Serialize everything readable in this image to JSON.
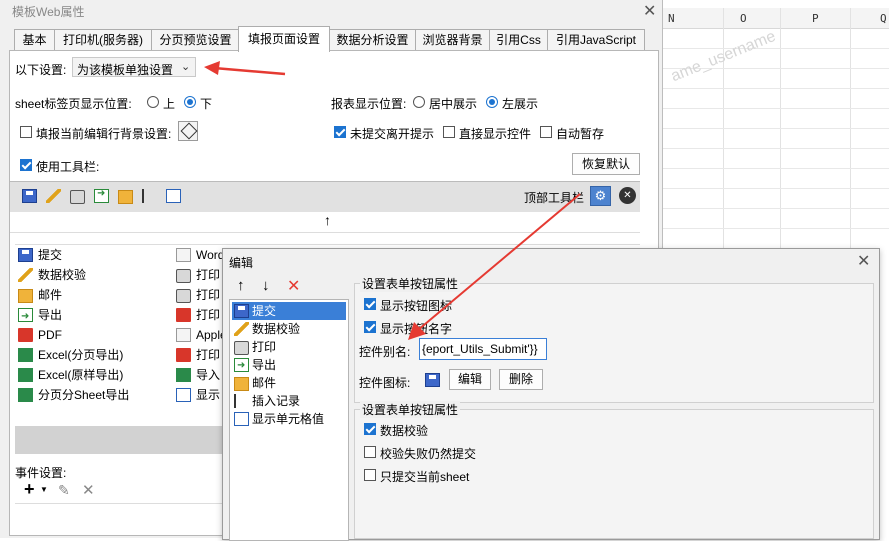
{
  "spreadsheet": {
    "columns": [
      "N",
      "O",
      "P",
      "Q"
    ],
    "watermark": "ame_username"
  },
  "main_dialog": {
    "title": "模板Web属性",
    "tabs": [
      {
        "label": "基本",
        "selected": false
      },
      {
        "label": "打印机(服务器)",
        "selected": false
      },
      {
        "label": "分页预览设置",
        "selected": false
      },
      {
        "label": "填报页面设置",
        "selected": true
      },
      {
        "label": "数据分析设置",
        "selected": false
      },
      {
        "label": "浏览器背景",
        "selected": false
      },
      {
        "label": "引用Css",
        "selected": false
      },
      {
        "label": "引用JavaScript",
        "selected": false
      }
    ],
    "settings_label": "以下设置:",
    "settings_select": "为该模板单独设置",
    "sheet_tab_pos_label": "sheet标签页显示位置:",
    "sheet_tab_pos_options": [
      "上",
      "下"
    ],
    "sheet_tab_pos_selected": "下",
    "report_pos_label": "报表显示位置:",
    "report_pos_options": [
      "居中展示",
      "左展示"
    ],
    "report_pos_selected": "左展示",
    "fill_row_bg_label": "填报当前编辑行背景设置:",
    "fill_row_bg_checked": false,
    "unsubmitted_leave_label": "未提交离开提示",
    "unsubmitted_leave_checked": true,
    "direct_show_control_label": "直接显示控件",
    "direct_show_control_checked": false,
    "auto_save_label": "自动暂存",
    "auto_save_checked": false,
    "use_toolbar_label": "使用工具栏:",
    "use_toolbar_checked": true,
    "restore_default_button": "恢复默认",
    "top_toolbar_label": "顶部工具栏",
    "move_up_arrow": "↑",
    "button_list_col1": [
      "提交",
      "数据校验",
      "邮件",
      "导出",
      "PDF",
      "Excel(分页导出)",
      "Excel(原样导出)",
      "分页分Sheet导出"
    ],
    "button_list_col2": [
      "Word",
      "打印",
      "打印",
      "打印",
      "Apple",
      "打印",
      "导入",
      "显示"
    ],
    "event_settings_label": "事件设置:",
    "event_add_icon": "+",
    "event_delete_icon": "✕"
  },
  "edit_dialog": {
    "title": "编辑",
    "items": [
      "提交",
      "数据校验",
      "打印",
      "导出",
      "邮件",
      "插入记录",
      "显示单元格值"
    ],
    "selected_index": 0,
    "group1_title": "设置表单按钮属性",
    "show_icon_label": "显示按钮图标",
    "show_icon_checked": true,
    "show_name_label": "显示按钮名字",
    "show_name_checked": true,
    "control_alias_label": "控件别名:",
    "control_alias_value": "{eport_Utils_Submit'}}",
    "control_icon_label": "控件图标:",
    "edit_button": "编辑",
    "delete_button": "删除",
    "group2_title": "设置表单按钮属性",
    "data_validate_label": "数据校验",
    "data_validate_checked": true,
    "submit_on_fail_label": "校验失败仍然提交",
    "submit_on_fail_checked": false,
    "submit_current_sheet_label": "只提交当前sheet",
    "submit_current_sheet_checked": false
  },
  "colors": {
    "accent": "#1c73d0",
    "selection": "#3a7fd7",
    "annotation_arrow": "#e53a32"
  }
}
